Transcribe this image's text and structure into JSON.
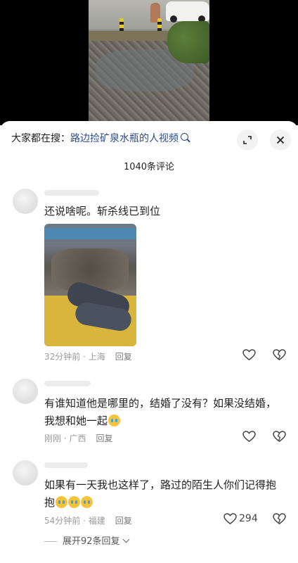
{
  "search": {
    "prefix": "大家都在搜：",
    "term": "路边捡矿泉水瓶的人视频"
  },
  "comment_count": "1040条评论",
  "comments": [
    {
      "text": "还说啥呢。斩杀线已到位",
      "time": "32分钟前",
      "location": "上海",
      "reply_label": "回复",
      "has_photo": true
    },
    {
      "text_line1": "有谁知道他是哪里的，结婚了没有？如果没结婚，",
      "text_line2": "我想和她一起",
      "time": "刚刚",
      "location": "广西",
      "reply_label": "回复"
    },
    {
      "text_line1": "如果有一天我也这样了，路过的陌生人你们记得抱",
      "text_line2": "抱",
      "time": "54分钟前",
      "location": "福建",
      "reply_label": "回复",
      "likes": "294"
    }
  ],
  "expand_replies": "展开92条回复",
  "icons": [
    "search-icon",
    "expand-icon",
    "close-icon",
    "heart-icon",
    "broken-heart-icon",
    "crying-emoji-icon",
    "chevron-down-icon"
  ]
}
